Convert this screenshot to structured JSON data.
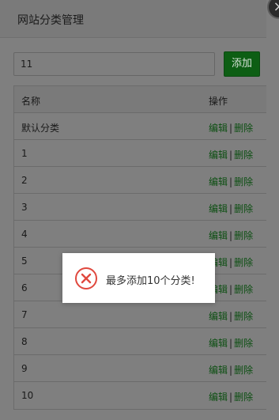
{
  "dialog": {
    "title": "网站分类管理",
    "close_glyph": "×"
  },
  "form": {
    "input_value": "11",
    "add_label": "添加"
  },
  "table": {
    "headers": {
      "name": "名称",
      "ops": "操作"
    },
    "rows": [
      {
        "name": "默认分类",
        "edit": "编辑",
        "sep": "|",
        "delete": "删除"
      },
      {
        "name": "1",
        "edit": "编辑",
        "sep": "|",
        "delete": "删除"
      },
      {
        "name": "2",
        "edit": "编辑",
        "sep": "|",
        "delete": "删除"
      },
      {
        "name": "3",
        "edit": "编辑",
        "sep": "|",
        "delete": "删除"
      },
      {
        "name": "4",
        "edit": "编辑",
        "sep": "|",
        "delete": "删除"
      },
      {
        "name": "5",
        "edit": "编辑",
        "sep": "|",
        "delete": "删除"
      },
      {
        "name": "6",
        "edit": "编辑",
        "sep": "|",
        "delete": "删除"
      },
      {
        "name": "7",
        "edit": "编辑",
        "sep": "|",
        "delete": "删除"
      },
      {
        "name": "8",
        "edit": "编辑",
        "sep": "|",
        "delete": "删除"
      },
      {
        "name": "9",
        "edit": "编辑",
        "sep": "|",
        "delete": "删除"
      },
      {
        "name": "10",
        "edit": "编辑",
        "sep": "|",
        "delete": "删除"
      }
    ]
  },
  "toast": {
    "icon": "error-circle-icon",
    "message": "最多添加10个分类!",
    "icon_color": "#e0483e"
  },
  "colors": {
    "accent_green": "#0d5e14",
    "link_green": "#0c4f12",
    "overlay": "#7f7f7f"
  }
}
